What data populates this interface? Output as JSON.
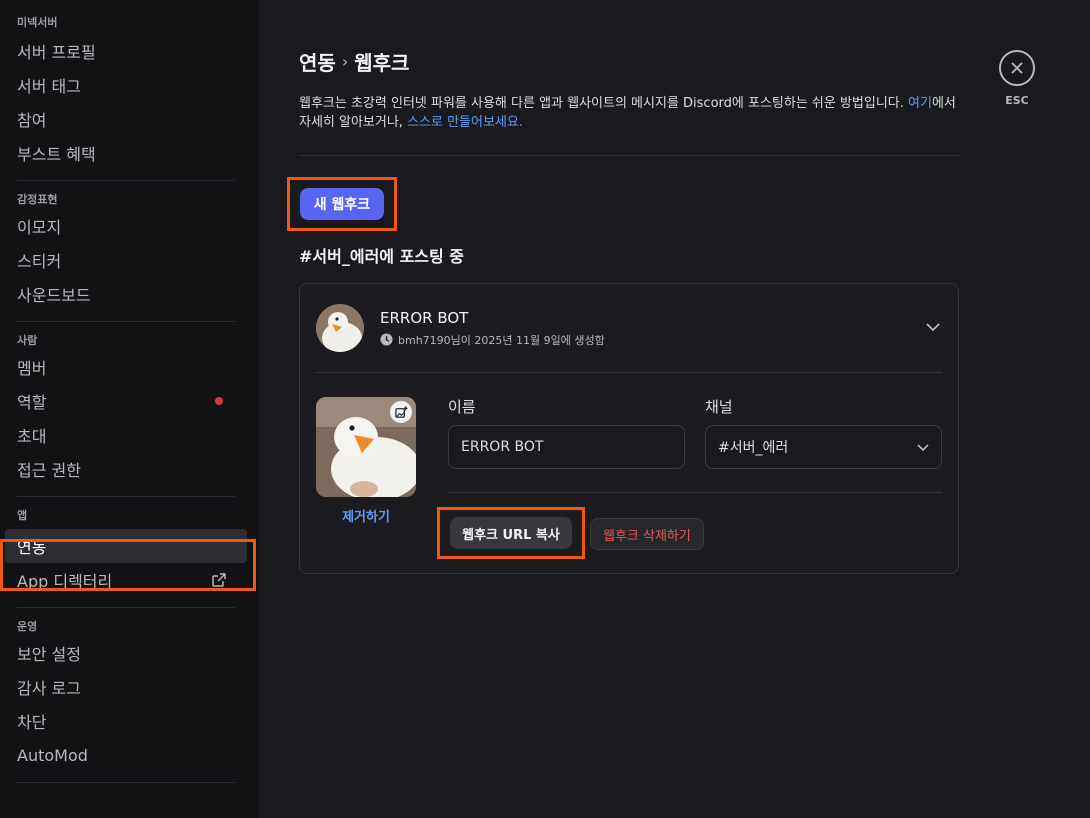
{
  "sidebar": {
    "sections": [
      {
        "header": "미넥서버",
        "items": [
          {
            "label": "서버 프로필"
          },
          {
            "label": "서버 태그"
          },
          {
            "label": "참여"
          },
          {
            "label": "부스트 혜택"
          }
        ]
      },
      {
        "header": "감정표현",
        "items": [
          {
            "label": "이모지"
          },
          {
            "label": "스티커"
          },
          {
            "label": "사운드보드"
          }
        ]
      },
      {
        "header": "사람",
        "items": [
          {
            "label": "멤버"
          },
          {
            "label": "역할"
          },
          {
            "label": "초대"
          },
          {
            "label": "접근 권한"
          }
        ]
      },
      {
        "header": "앱",
        "items": [
          {
            "label": "연동"
          },
          {
            "label": "App 디렉터리"
          }
        ]
      },
      {
        "header": "운영",
        "items": [
          {
            "label": "보안 설정"
          },
          {
            "label": "감사 로그"
          },
          {
            "label": "차단"
          },
          {
            "label": "AutoMod"
          }
        ]
      }
    ],
    "active_item": "연동"
  },
  "breadcrumb": {
    "parent": "연동",
    "current": "웹후크"
  },
  "description": {
    "text1": "웹후크는 초강력 인터넷 파워를 사용해 다른 앱과 웹사이트의 메시지를 Discord에 포스팅하는 쉬운 방법입니다. ",
    "link1": "여기",
    "text2": "에서 자세히 알아보거나, ",
    "link2": "스스로 만들어보세요."
  },
  "new_webhook_button": "새 웹후크",
  "posting_label": "#서버_에러에 포스팅 중",
  "webhook": {
    "name": "ERROR BOT",
    "meta": "bmh7190님이 2025년 11월 9일에 생성함",
    "remove_label": "제거하기",
    "name_label": "이름",
    "name_value": "ERROR BOT",
    "channel_label": "채널",
    "channel_value": "#서버_에러",
    "copy_url_button": "웹후크 URL 복사",
    "delete_button": "웹후크 삭제하기"
  },
  "esc_label": "ESC",
  "colors": {
    "accent": "#5865f2",
    "highlight": "#f05a0e",
    "link": "#5c9cf5",
    "danger": "#e5575a"
  }
}
